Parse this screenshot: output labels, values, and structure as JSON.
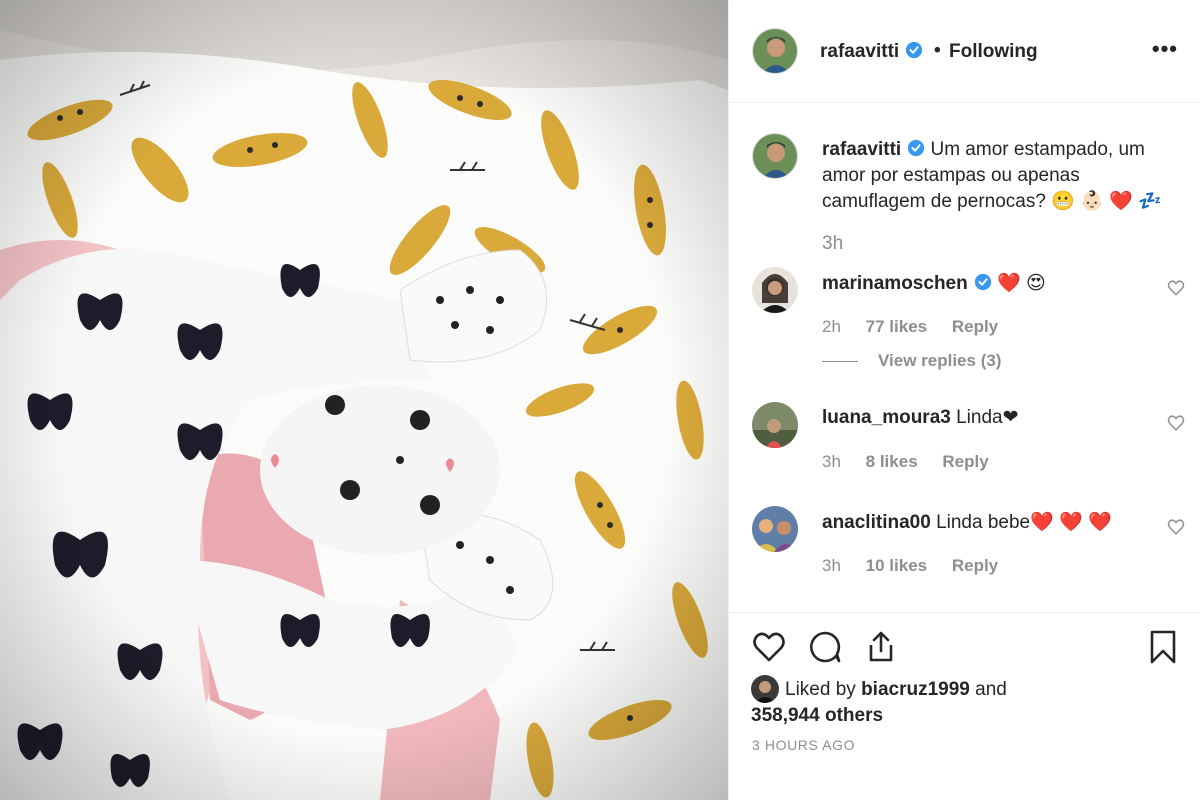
{
  "post": {
    "username": "rafaavitti",
    "separator": "•",
    "follow_label": "Following",
    "more_label": "•••"
  },
  "caption": {
    "username": "rafaavitti",
    "text": "Um amor estampado, um amor por estampas ou apenas camuflagem de pernocas? 😬 👶🏻 ❤️ 💤",
    "time": "3h"
  },
  "comments": [
    {
      "username": "marinamoschen",
      "text": "❤️ 😍",
      "time": "2h",
      "likes": "77 likes",
      "reply": "Reply",
      "view_replies": "View replies (3)"
    },
    {
      "username": "luana_moura3",
      "text": "Linda❤",
      "time": "3h",
      "likes": "8 likes",
      "reply": "Reply"
    },
    {
      "username": "anaclitina00",
      "text": "Linda bebe❤️ ❤️ ❤️",
      "time": "3h",
      "likes": "10 likes",
      "reply": "Reply"
    }
  ],
  "likes": {
    "prefix": "Liked by",
    "user": "biacruz1999",
    "and": "and",
    "count": "358,944 others"
  },
  "timestamp": "3 HOURS AGO",
  "icons": {
    "like": "heart-outline-icon",
    "comment": "speech-bubble-icon",
    "share": "share-icon",
    "save": "bookmark-icon",
    "verified": "verified-badge-icon"
  },
  "colors": {
    "verified": "#3897f0",
    "muted": "#8e8e8e",
    "text": "#262626",
    "border": "#efefef"
  }
}
